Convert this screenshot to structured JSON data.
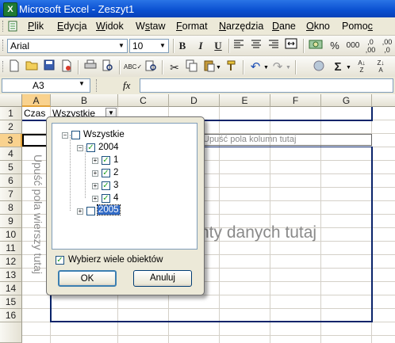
{
  "window": {
    "title": "Microsoft Excel - Zeszyt1"
  },
  "menu": {
    "items": [
      {
        "label": "Plik",
        "accel": "P"
      },
      {
        "label": "Edycja",
        "accel": "E"
      },
      {
        "label": "Widok",
        "accel": "W"
      },
      {
        "label": "Wstaw",
        "accel": "s"
      },
      {
        "label": "Format",
        "accel": "F"
      },
      {
        "label": "Narzędzia",
        "accel": "N"
      },
      {
        "label": "Dane",
        "accel": "D"
      },
      {
        "label": "Okno",
        "accel": "O"
      },
      {
        "label": "Pomoc",
        "accel": "c"
      }
    ]
  },
  "formatting": {
    "font": "Arial",
    "size": "10",
    "bold": "B",
    "italic": "I",
    "underline": "U",
    "percent": "%",
    "thousands": "000"
  },
  "formula": {
    "cell_ref": "A3",
    "fx": "fx",
    "value": ""
  },
  "grid": {
    "columns": [
      "A",
      "B",
      "C",
      "D",
      "E",
      "F",
      "G"
    ],
    "rows": [
      "1",
      "2",
      "3",
      "4",
      "5",
      "6",
      "7",
      "8",
      "9",
      "10",
      "11",
      "12",
      "13",
      "14",
      "15",
      "16"
    ],
    "selected_col": "A",
    "selected_row": "3",
    "a1": "Czas",
    "b1": "Wszystkie"
  },
  "pivot": {
    "column_hint": "Upuść pola kolumn tutaj",
    "row_hint": "Upuść pola wierszy tutaj",
    "data_hint_visible": "nty danych tutaj"
  },
  "dialog": {
    "tree": [
      {
        "label": "Wszystkie",
        "level": 0,
        "checked": false,
        "expander": "−"
      },
      {
        "label": "2004",
        "level": 1,
        "checked": true,
        "expander": "−"
      },
      {
        "label": "1",
        "level": 2,
        "checked": true,
        "expander": "+"
      },
      {
        "label": "2",
        "level": 2,
        "checked": true,
        "expander": "+"
      },
      {
        "label": "3",
        "level": 2,
        "checked": true,
        "expander": "+"
      },
      {
        "label": "4",
        "level": 2,
        "checked": true,
        "expander": "+"
      },
      {
        "label": "2005",
        "level": 1,
        "checked": false,
        "expander": "+",
        "selected": true
      }
    ],
    "multi_select_label": "Wybierz wiele obiektów",
    "multi_select_checked": true,
    "ok_label": "OK",
    "cancel_label": "Anuluj"
  },
  "colors": {
    "title_blue": "#0a4fd0",
    "pivot_border": "#0a246a",
    "selected_header": "#f9d28e",
    "tree_selection": "#316ac5"
  }
}
